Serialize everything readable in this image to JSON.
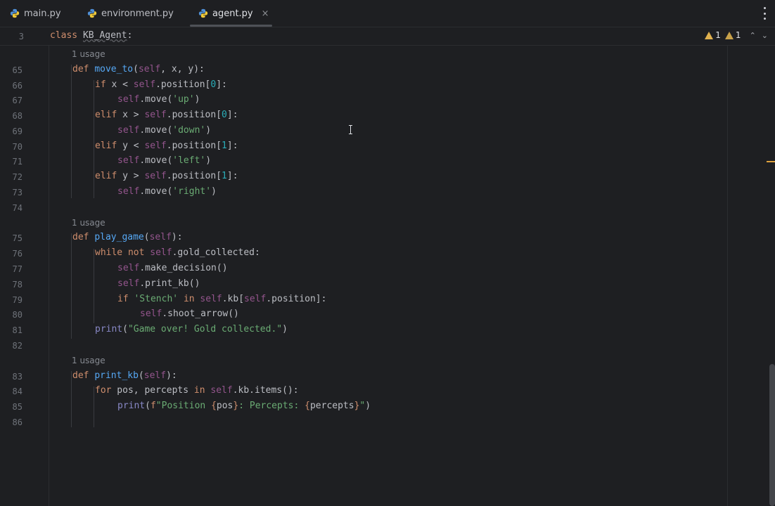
{
  "tabs": [
    {
      "label": "main.py",
      "active": false
    },
    {
      "label": "environment.py",
      "active": false
    },
    {
      "label": "agent.py",
      "active": true
    }
  ],
  "tab_close_glyph": "×",
  "sticky_header": {
    "line": "3",
    "code": "class KB_Agent:"
  },
  "inspections": {
    "warnings": "1",
    "weak_warnings": "1"
  },
  "usage_hints": [
    "1 usage",
    "1 usage",
    "1 usage"
  ],
  "lines": [
    {
      "n": "65",
      "code": "def move_to(self, x, y):"
    },
    {
      "n": "66",
      "code": "if x < self.position[0]:"
    },
    {
      "n": "67",
      "code": "self.move('up')"
    },
    {
      "n": "68",
      "code": "elif x > self.position[0]:"
    },
    {
      "n": "69",
      "code": "self.move('down')"
    },
    {
      "n": "70",
      "code": "elif y < self.position[1]:"
    },
    {
      "n": "71",
      "code": "self.move('left')"
    },
    {
      "n": "72",
      "code": "elif y > self.position[1]:"
    },
    {
      "n": "73",
      "code": "self.move('right')"
    },
    {
      "n": "74",
      "code": ""
    },
    {
      "n": "75",
      "code": "def play_game(self):"
    },
    {
      "n": "76",
      "code": "while not self.gold_collected:"
    },
    {
      "n": "77",
      "code": "self.make_decision()"
    },
    {
      "n": "78",
      "code": "self.print_kb()"
    },
    {
      "n": "79",
      "code": "if 'Stench' in self.kb[self.position]:"
    },
    {
      "n": "80",
      "code": "self.shoot_arrow()"
    },
    {
      "n": "81",
      "code": "print(\"Game over! Gold collected.\")"
    },
    {
      "n": "82",
      "code": ""
    },
    {
      "n": "83",
      "code": "def print_kb(self):"
    },
    {
      "n": "84",
      "code": "for pos, percepts in self.kb.items():"
    },
    {
      "n": "85",
      "code": "print(f\"Position {pos}: Percepts: {percepts}\")"
    },
    {
      "n": "86",
      "code": ""
    }
  ],
  "colors": {
    "background": "#1e1f22",
    "keyword": "#cf8e6d",
    "function": "#56a8f5",
    "self": "#94558d",
    "string": "#6aab73",
    "number": "#2aacb8",
    "builtin": "#8888c6",
    "warning": "#e0b14f"
  },
  "icons": [
    "python-file-icon",
    "close-icon",
    "more-vertical-icon",
    "warning-icon",
    "chevron-up-icon",
    "chevron-down-icon",
    "text-cursor-icon"
  ]
}
